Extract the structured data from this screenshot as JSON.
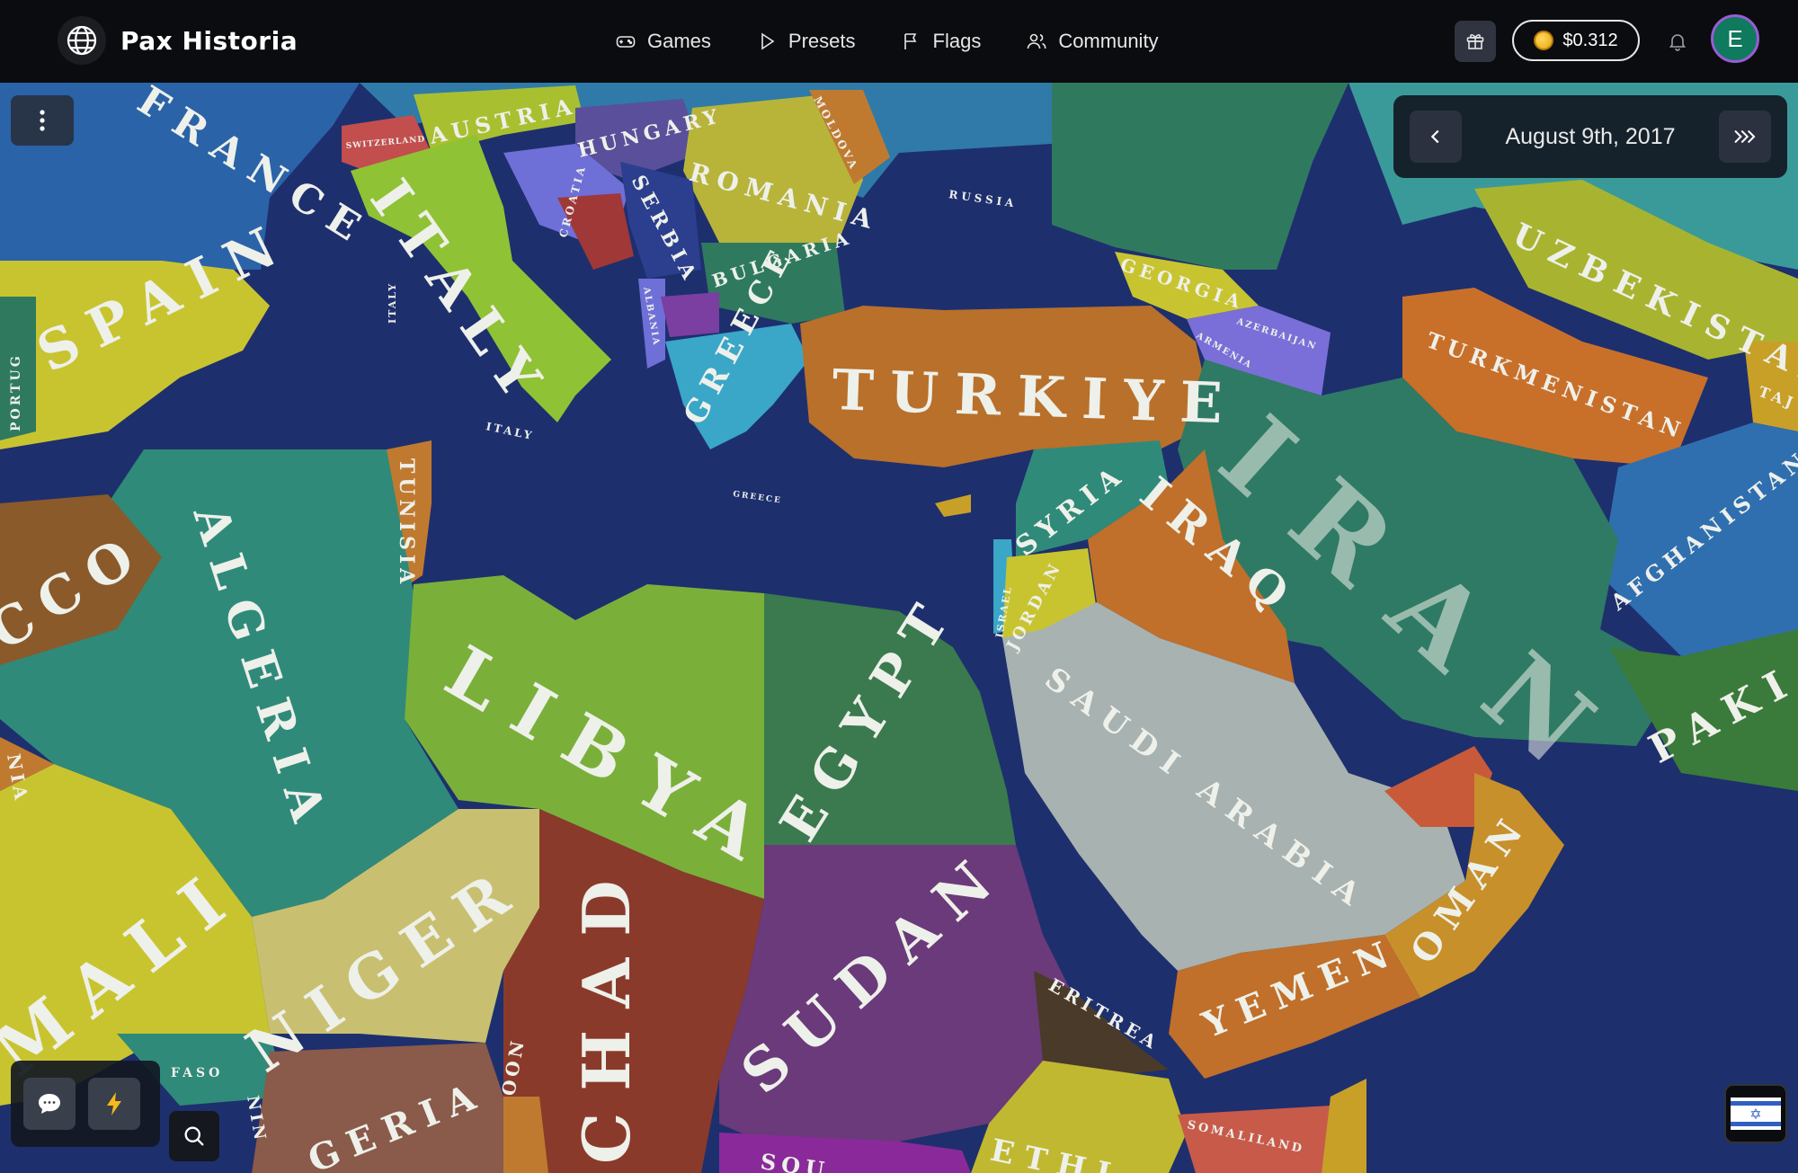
{
  "app": {
    "name": "Pax Historia"
  },
  "nav": [
    {
      "label": "Games",
      "icon": "gamepad-icon"
    },
    {
      "label": "Presets",
      "icon": "play-icon"
    },
    {
      "label": "Flags",
      "icon": "flag-icon"
    },
    {
      "label": "Community",
      "icon": "users-icon"
    }
  ],
  "account": {
    "balance": "$0.312",
    "avatar_initial": "E"
  },
  "timeline": {
    "date": "August 9th, 2017"
  },
  "map": {
    "labels": {
      "france": "FRANCE",
      "austria": "AUSTRIA",
      "hungary": "HUNGARY",
      "moldova": "MOLDOVA",
      "romania": "ROMANIA",
      "russia": "RUSSIA",
      "switzerland": "SWITZERLAND",
      "croatia": "CROATIA",
      "serbia": "SERBIA",
      "bulgaria": "BULGARIA",
      "italy": "ITALY",
      "italy_small1": "ITALY",
      "italy_small2": "ITALY",
      "greece": "GREECE",
      "greece_small": "GREECE",
      "albania": "ALBANIA",
      "georgia": "GEORGIA",
      "azerbaijan": "AZERBAIJAN",
      "armenia": "ARMENIA",
      "uzbekistan": "UZBEKISTAN",
      "turkmenistan": "TURKMENISTAN",
      "tajik": "TAJ",
      "spain": "SPAIN",
      "portugal": "PORTUG",
      "turkiye": "TURKIYE",
      "iran": "IRAN",
      "tunisia": "TUNISIA",
      "syria": "SYRIA",
      "iraq": "IRAQ",
      "algeria": "ALGERIA",
      "morocco": "CCO",
      "israel": "ISRAEL",
      "jordan": "JORDAN",
      "afghanistan": "AFGHANISTAN",
      "libya": "LIBYA",
      "egypt": "EGYPT",
      "saudi": "SAUDI ARABIA",
      "pakistan": "PAKI",
      "mali": "MALI",
      "niger": "NIGER",
      "chad": "CHAD",
      "sudan": "SUDAN",
      "oman": "OMAN",
      "yemen": "YEMEN",
      "eritrea": "ERITREA",
      "faso": "FASO",
      "nigeria": "GERIA",
      "somaliland": "SOMALILAND",
      "ethiopia": "ETHI",
      "benin": "NIN",
      "cameroon": "OON",
      "south_sudan": "SOU",
      "mauritania": "NIA"
    }
  },
  "colors": {
    "sea": "#1e2f6e",
    "topbar": "#0b0c0f",
    "avatar_bg": "#0f7a5e",
    "avatar_ring": "#9b5bd6"
  }
}
